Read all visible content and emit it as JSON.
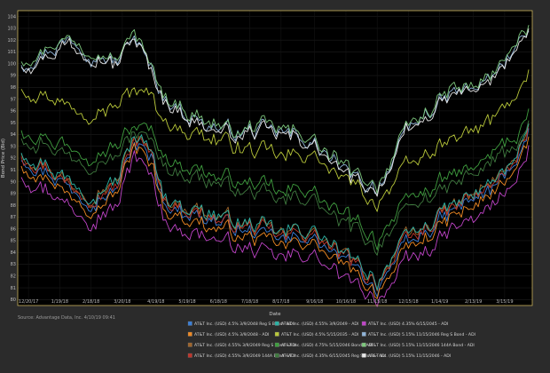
{
  "chart_data": {
    "type": "line",
    "xlabel": "Date",
    "ylabel": "Bond Price (Bid)",
    "source": "Source: Advantage Data, Inc. 4/10/19 09:41",
    "ylim": [
      79.5,
      104.5
    ],
    "y_ticks": [
      80,
      81,
      82,
      83,
      84,
      85,
      86,
      87,
      88,
      89,
      90,
      91,
      92,
      93,
      94,
      95,
      96,
      97,
      98,
      99,
      100,
      101,
      102,
      103,
      104
    ],
    "x_ticks": [
      "12/20/17",
      "1/19/18",
      "2/18/18",
      "3/20/18",
      "4/19/18",
      "5/19/18",
      "6/18/18",
      "7/18/18",
      "8/17/18",
      "9/16/18",
      "10/16/18",
      "11/15/18",
      "12/15/18",
      "1/14/19",
      "2/13/19",
      "3/15/19"
    ],
    "x_tick_index": [
      3,
      16,
      29,
      42,
      56,
      69,
      82,
      95,
      108,
      122,
      135,
      148,
      161,
      174,
      188,
      201
    ],
    "n_points": 212,
    "grid": true,
    "legend_position": "bottom",
    "series": [
      {
        "name": "AT&T Inc. (USD) 4.5% 3/9/2048 Reg S Bond - ADI",
        "color": "#3a7fd8",
        "anchors": [
          [
            0,
            92.0
          ],
          [
            10,
            91.0
          ],
          [
            20,
            89.5
          ],
          [
            30,
            88.5
          ],
          [
            40,
            89.5
          ],
          [
            47,
            93.5
          ],
          [
            55,
            91.5
          ],
          [
            60,
            88.0
          ],
          [
            75,
            87.0
          ],
          [
            90,
            86.0
          ],
          [
            100,
            85.5
          ],
          [
            110,
            85.0
          ],
          [
            120,
            85.5
          ],
          [
            130,
            83.8
          ],
          [
            140,
            82.5
          ],
          [
            148,
            81.0
          ],
          [
            152,
            82.5
          ],
          [
            160,
            84.5
          ],
          [
            170,
            86.0
          ],
          [
            180,
            87.5
          ],
          [
            190,
            88.5
          ],
          [
            200,
            90.0
          ],
          [
            206,
            92.0
          ],
          [
            211,
            94.0
          ]
        ]
      },
      {
        "name": "AT&T Inc. (USD) 4.5% 3/9/2048 - ADI",
        "color": "#f08a24",
        "anchors": [
          [
            0,
            91.5
          ],
          [
            10,
            90.5
          ],
          [
            20,
            89.0
          ],
          [
            30,
            88.0
          ],
          [
            40,
            89.0
          ],
          [
            47,
            93.2
          ],
          [
            55,
            91.0
          ],
          [
            60,
            87.5
          ],
          [
            75,
            86.5
          ],
          [
            90,
            85.5
          ],
          [
            100,
            85.0
          ],
          [
            110,
            84.5
          ],
          [
            120,
            85.0
          ],
          [
            130,
            83.3
          ],
          [
            140,
            82.0
          ],
          [
            148,
            80.6
          ],
          [
            152,
            82.0
          ],
          [
            160,
            84.0
          ],
          [
            170,
            85.5
          ],
          [
            180,
            87.0
          ],
          [
            190,
            88.0
          ],
          [
            200,
            89.6
          ],
          [
            206,
            91.6
          ],
          [
            211,
            93.6
          ]
        ]
      },
      {
        "name": "AT&T Inc. (USD) 4.55% 3/9/2049 Reg S Bond - ADI",
        "color": "#a0652b",
        "anchors": [
          [
            0,
            92.5
          ],
          [
            10,
            91.5
          ],
          [
            20,
            90.0
          ],
          [
            30,
            89.0
          ],
          [
            40,
            90.0
          ],
          [
            47,
            94.0
          ],
          [
            55,
            92.0
          ],
          [
            60,
            88.5
          ],
          [
            75,
            87.5
          ],
          [
            90,
            86.5
          ],
          [
            100,
            86.0
          ],
          [
            110,
            85.5
          ],
          [
            120,
            86.0
          ],
          [
            130,
            84.3
          ],
          [
            140,
            83.0
          ],
          [
            148,
            81.5
          ],
          [
            152,
            83.0
          ],
          [
            160,
            85.0
          ],
          [
            170,
            86.5
          ],
          [
            180,
            88.0
          ],
          [
            190,
            89.0
          ],
          [
            200,
            90.5
          ],
          [
            206,
            92.5
          ],
          [
            211,
            94.5
          ]
        ]
      },
      {
        "name": "AT&T Inc. (USD) 4.55% 3/9/2049 144A Bond - ADI",
        "color": "#c0352b",
        "anchors": [
          [
            0,
            92.3
          ],
          [
            10,
            91.3
          ],
          [
            20,
            89.8
          ],
          [
            30,
            88.8
          ],
          [
            40,
            89.8
          ],
          [
            47,
            93.8
          ],
          [
            55,
            91.8
          ],
          [
            60,
            88.3
          ],
          [
            75,
            87.3
          ],
          [
            90,
            86.3
          ],
          [
            100,
            85.8
          ],
          [
            110,
            85.3
          ],
          [
            120,
            85.8
          ],
          [
            130,
            84.1
          ],
          [
            140,
            82.8
          ],
          [
            148,
            81.3
          ],
          [
            152,
            82.8
          ],
          [
            160,
            84.8
          ],
          [
            170,
            86.3
          ],
          [
            180,
            87.8
          ],
          [
            190,
            88.8
          ],
          [
            200,
            90.3
          ],
          [
            206,
            92.3
          ],
          [
            211,
            94.3
          ]
        ]
      },
      {
        "name": "AT&T Inc. (USD) 4.55% 3/9/2049 - ADI",
        "color": "#2ab3a6",
        "anchors": [
          [
            0,
            92.6
          ],
          [
            10,
            91.6
          ],
          [
            20,
            90.1
          ],
          [
            30,
            89.1
          ],
          [
            40,
            90.1
          ],
          [
            47,
            94.1
          ],
          [
            55,
            92.1
          ],
          [
            60,
            88.6
          ],
          [
            75,
            87.6
          ],
          [
            90,
            86.6
          ],
          [
            100,
            86.1
          ],
          [
            110,
            85.6
          ],
          [
            120,
            86.1
          ],
          [
            130,
            84.4
          ],
          [
            140,
            83.1
          ],
          [
            148,
            81.6
          ],
          [
            152,
            83.1
          ],
          [
            160,
            85.1
          ],
          [
            170,
            86.6
          ],
          [
            180,
            88.1
          ],
          [
            190,
            89.1
          ],
          [
            200,
            90.6
          ],
          [
            206,
            92.6
          ],
          [
            211,
            94.6
          ]
        ]
      },
      {
        "name": "AT&T Inc. (USD) 4.5% 5/15/2035 - ADI",
        "color": "#b9c83a",
        "anchors": [
          [
            0,
            98.0
          ],
          [
            10,
            97.5
          ],
          [
            20,
            96.5
          ],
          [
            30,
            96.0
          ],
          [
            40,
            96.5
          ],
          [
            47,
            98.0
          ],
          [
            55,
            97.0
          ],
          [
            60,
            95.0
          ],
          [
            75,
            94.0
          ],
          [
            90,
            93.0
          ],
          [
            100,
            92.5
          ],
          [
            110,
            92.0
          ],
          [
            120,
            92.5
          ],
          [
            130,
            90.5
          ],
          [
            140,
            89.5
          ],
          [
            148,
            88.0
          ],
          [
            152,
            89.5
          ],
          [
            160,
            91.0
          ],
          [
            170,
            92.5
          ],
          [
            180,
            93.5
          ],
          [
            190,
            94.5
          ],
          [
            200,
            96.0
          ],
          [
            206,
            97.5
          ],
          [
            211,
            99.0
          ]
        ]
      },
      {
        "name": "AT&T Inc. (USD) 4.75% 5/15/2046 Bond - ADI",
        "color": "#3f9e3f",
        "anchors": [
          [
            0,
            94.5
          ],
          [
            10,
            94.0
          ],
          [
            20,
            93.0
          ],
          [
            30,
            92.5
          ],
          [
            40,
            93.0
          ],
          [
            47,
            95.0
          ],
          [
            55,
            94.0
          ],
          [
            60,
            92.0
          ],
          [
            75,
            91.0
          ],
          [
            90,
            90.0
          ],
          [
            100,
            89.5
          ],
          [
            110,
            89.0
          ],
          [
            120,
            89.5
          ],
          [
            130,
            87.5
          ],
          [
            140,
            86.5
          ],
          [
            148,
            85.0
          ],
          [
            152,
            86.5
          ],
          [
            160,
            88.0
          ],
          [
            170,
            89.5
          ],
          [
            180,
            90.5
          ],
          [
            190,
            91.5
          ],
          [
            200,
            93.0
          ],
          [
            206,
            94.0
          ],
          [
            211,
            95.5
          ]
        ]
      },
      {
        "name": "AT&T Inc. (USD) 4.35% 6/15/2045 Reg S Bond - ADI",
        "color": "#3f7a3f",
        "anchors": [
          [
            0,
            93.8
          ],
          [
            10,
            93.3
          ],
          [
            20,
            92.3
          ],
          [
            30,
            91.8
          ],
          [
            40,
            92.3
          ],
          [
            47,
            94.3
          ],
          [
            55,
            93.3
          ],
          [
            60,
            91.3
          ],
          [
            75,
            90.3
          ],
          [
            90,
            89.3
          ],
          [
            100,
            88.8
          ],
          [
            110,
            88.3
          ],
          [
            120,
            88.8
          ],
          [
            130,
            86.8
          ],
          [
            140,
            85.8
          ],
          [
            148,
            84.3
          ],
          [
            152,
            85.8
          ],
          [
            160,
            87.3
          ],
          [
            170,
            88.8
          ],
          [
            180,
            89.8
          ],
          [
            190,
            90.8
          ],
          [
            200,
            92.3
          ],
          [
            206,
            93.3
          ],
          [
            211,
            94.8
          ]
        ]
      },
      {
        "name": "AT&T Inc. (USD) 4.35% 6/15/2045 - ADI",
        "color": "#c044c8",
        "anchors": [
          [
            0,
            90.5
          ],
          [
            10,
            89.5
          ],
          [
            20,
            88.0
          ],
          [
            30,
            87.0
          ],
          [
            40,
            88.0
          ],
          [
            47,
            92.5
          ],
          [
            55,
            90.0
          ],
          [
            60,
            86.5
          ],
          [
            75,
            85.5
          ],
          [
            90,
            84.5
          ],
          [
            100,
            84.0
          ],
          [
            110,
            83.5
          ],
          [
            120,
            84.0
          ],
          [
            130,
            82.3
          ],
          [
            140,
            81.0
          ],
          [
            148,
            80.2
          ],
          [
            152,
            81.0
          ],
          [
            160,
            83.0
          ],
          [
            170,
            84.5
          ],
          [
            180,
            86.0
          ],
          [
            190,
            87.0
          ],
          [
            200,
            88.5
          ],
          [
            206,
            90.5
          ],
          [
            211,
            92.5
          ]
        ]
      },
      {
        "name": "AT&T Inc. (USD) 5.15% 11/15/2046 Reg S Bond - ADI",
        "color": "#8fb4d8",
        "anchors": [
          [
            0,
            100.0
          ],
          [
            10,
            101.0
          ],
          [
            20,
            102.0
          ],
          [
            30,
            101.0
          ],
          [
            40,
            100.0
          ],
          [
            47,
            102.5
          ],
          [
            55,
            99.0
          ],
          [
            60,
            97.0
          ],
          [
            75,
            95.0
          ],
          [
            90,
            94.0
          ],
          [
            100,
            94.5
          ],
          [
            110,
            94.0
          ],
          [
            120,
            93.5
          ],
          [
            130,
            91.5
          ],
          [
            140,
            90.0
          ],
          [
            148,
            89.5
          ],
          [
            152,
            91.0
          ],
          [
            160,
            94.0
          ],
          [
            170,
            96.0
          ],
          [
            180,
            97.5
          ],
          [
            190,
            98.0
          ],
          [
            200,
            99.5
          ],
          [
            206,
            102.0
          ],
          [
            211,
            102.5
          ]
        ]
      },
      {
        "name": "AT&T Inc. (USD) 5.15% 11/15/2046 144A Bond - ADI",
        "color": "#7dc87d",
        "anchors": [
          [
            0,
            100.3
          ],
          [
            10,
            101.3
          ],
          [
            20,
            102.3
          ],
          [
            30,
            101.3
          ],
          [
            40,
            100.3
          ],
          [
            47,
            102.8
          ],
          [
            55,
            99.3
          ],
          [
            60,
            97.3
          ],
          [
            75,
            95.3
          ],
          [
            90,
            94.3
          ],
          [
            100,
            94.8
          ],
          [
            110,
            94.3
          ],
          [
            120,
            93.8
          ],
          [
            130,
            91.8
          ],
          [
            140,
            90.3
          ],
          [
            148,
            89.8
          ],
          [
            152,
            91.3
          ],
          [
            160,
            94.3
          ],
          [
            170,
            96.3
          ],
          [
            180,
            97.8
          ],
          [
            190,
            98.3
          ],
          [
            200,
            99.8
          ],
          [
            206,
            102.3
          ],
          [
            211,
            102.8
          ]
        ]
      },
      {
        "name": "AT&T Inc. (USD) 5.15% 11/15/2046 - ADI",
        "color": "#e6e6e6",
        "anchors": [
          [
            0,
            99.8
          ],
          [
            10,
            100.8
          ],
          [
            20,
            101.8
          ],
          [
            30,
            100.8
          ],
          [
            40,
            99.8
          ],
          [
            47,
            102.3
          ],
          [
            55,
            98.8
          ],
          [
            60,
            96.8
          ],
          [
            75,
            94.8
          ],
          [
            90,
            93.8
          ],
          [
            100,
            94.3
          ],
          [
            110,
            93.8
          ],
          [
            120,
            93.3
          ],
          [
            130,
            91.3
          ],
          [
            140,
            89.8
          ],
          [
            148,
            89.3
          ],
          [
            152,
            90.8
          ],
          [
            160,
            93.8
          ],
          [
            170,
            95.8
          ],
          [
            180,
            97.3
          ],
          [
            190,
            97.8
          ],
          [
            200,
            99.3
          ],
          [
            206,
            101.8
          ],
          [
            211,
            102.3
          ]
        ]
      }
    ]
  }
}
